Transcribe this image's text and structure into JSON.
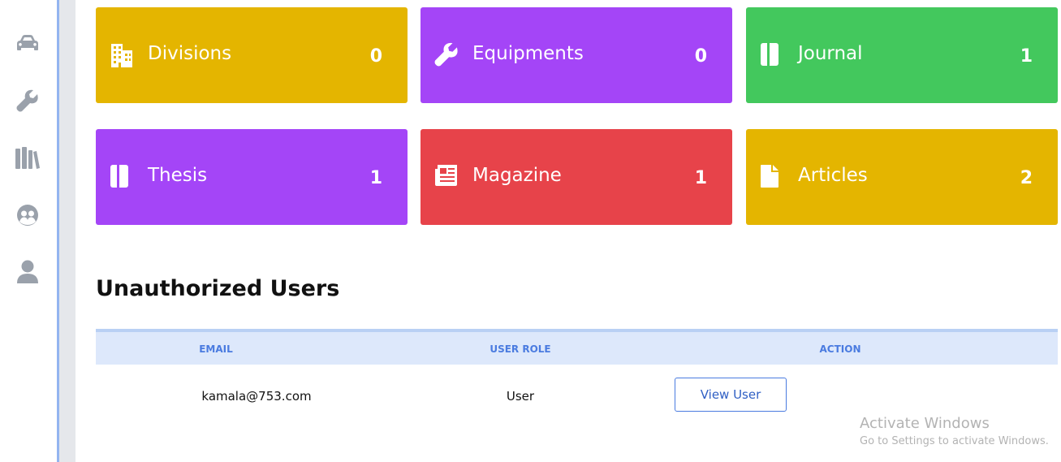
{
  "sidebar": {
    "icons": [
      "car-icon",
      "wrench-icon",
      "books-icon",
      "users-icon",
      "user-icon"
    ]
  },
  "cards": [
    {
      "label": "Divisions",
      "count": "0",
      "icon": "building-icon",
      "color": "#e4b500"
    },
    {
      "label": "Equipments",
      "count": "0",
      "icon": "wrench-icon",
      "color": "#a445f7"
    },
    {
      "label": "Journal",
      "count": "1",
      "icon": "book-icon",
      "color": "#43c85d"
    },
    {
      "label": "Thesis",
      "count": "1",
      "icon": "book-icon",
      "color": "#a445f7"
    },
    {
      "label": "Magazine",
      "count": "1",
      "icon": "newspaper-icon",
      "color": "#e7434a"
    },
    {
      "label": "Articles",
      "count": "2",
      "icon": "file-icon",
      "color": "#e4b500"
    }
  ],
  "unauthorized": {
    "title": "Unauthorized Users",
    "headers": {
      "email": "EMAIL",
      "role": "USER ROLE",
      "action": "ACTION"
    },
    "rows": [
      {
        "email": "kamala@753.com",
        "role": "User",
        "action_label": "View User"
      }
    ]
  },
  "watermark": {
    "line1": "Activate Windows",
    "line2": "Go to Settings to activate Windows."
  }
}
